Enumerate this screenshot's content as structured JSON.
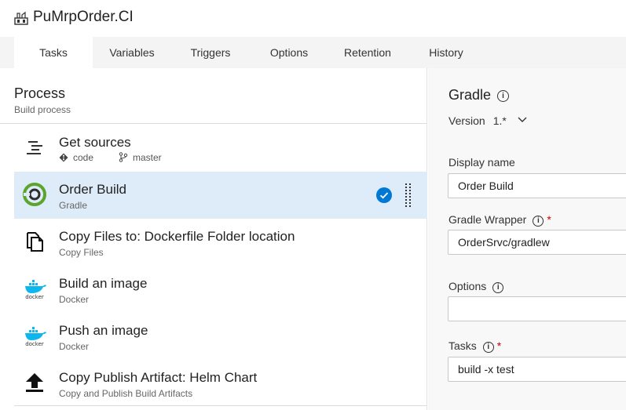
{
  "header": {
    "title": "PuMrpOrder.CI",
    "icon": "build-definition-icon"
  },
  "tabs": [
    {
      "label": "Tasks",
      "active": true
    },
    {
      "label": "Variables"
    },
    {
      "label": "Triggers"
    },
    {
      "label": "Options"
    },
    {
      "label": "Retention"
    },
    {
      "label": "History"
    }
  ],
  "process": {
    "title": "Process",
    "subtitle": "Build process"
  },
  "get_sources": {
    "title": "Get sources",
    "repo": "code",
    "branch": "master",
    "icon": "get-sources-icon"
  },
  "tasks": [
    {
      "name": "Order Build",
      "type": "Gradle",
      "icon": "gradle-icon",
      "selected": true
    },
    {
      "name": "Copy Files to: Dockerfile Folder location",
      "type": "Copy Files",
      "icon": "copy-files-icon"
    },
    {
      "name": "Build an image",
      "type": "Docker",
      "icon": "docker-icon",
      "icon_text": "docker"
    },
    {
      "name": "Push an image",
      "type": "Docker",
      "icon": "docker-icon",
      "icon_text": "docker"
    },
    {
      "name": "Copy Publish Artifact: Helm Chart",
      "type": "Copy and Publish Build Artifacts",
      "icon": "upload-artifact-icon"
    }
  ],
  "details": {
    "title": "Gradle",
    "version_label": "Version",
    "version_value": "1.*",
    "fields": {
      "display_name": {
        "label": "Display name",
        "value": "Order Build"
      },
      "gradle_wrapper": {
        "label": "Gradle Wrapper",
        "required": "*",
        "value": "OrderSrvc/gradlew"
      },
      "options": {
        "label": "Options",
        "value": ""
      },
      "tasks": {
        "label": "Tasks",
        "required": "*",
        "value": "build -x test"
      }
    }
  },
  "colors": {
    "accent": "#0078d4",
    "selected_row": "#deecf9",
    "gradle_green": "#02303a",
    "docker_blue": "#0db7ed"
  }
}
